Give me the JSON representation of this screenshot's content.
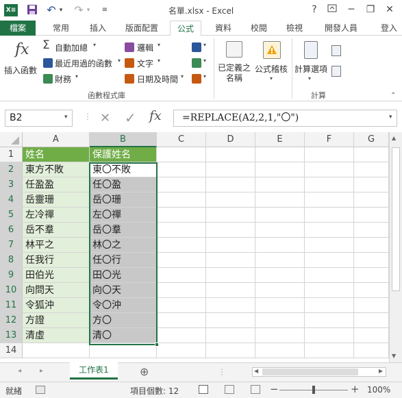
{
  "window": {
    "title": "名單.xlsx - Excel",
    "help": "?",
    "minimize": "─",
    "restore": "❐",
    "close": "✕",
    "sign_in": "登入"
  },
  "qat": {
    "excel_icon": "X≡",
    "save": "💾",
    "undo": "↶",
    "undo_arrow": "▾",
    "redo": "↷",
    "redo_arrow": "▾",
    "customize": "≡"
  },
  "tabs": [
    "檔案",
    "常用",
    "插入",
    "版面配置",
    "公式",
    "資料",
    "校閱",
    "檢視",
    "開發人員"
  ],
  "ribbon": {
    "insert_function": {
      "icon": "fx",
      "label": "插入函數"
    },
    "autosum": "自動加總",
    "recent": "最近用過的函數",
    "financial": "財務",
    "logical": "邏輯",
    "text": "文字",
    "datetime": "日期及時間",
    "group_library": "函數程式庫",
    "defined_names": "已定義之\n名稱",
    "formula_auditing": "公式稽核",
    "calc_options": "計算選項",
    "group_calc": "計算"
  },
  "formula_bar": {
    "name_box": "B2",
    "formula": "=REPLACE(A2,2,1,\"〇\")",
    "fx": "fx",
    "cancel": "✕",
    "enter": "✓"
  },
  "columns": [
    "A",
    "B",
    "C",
    "D",
    "E",
    "F",
    "G"
  ],
  "rows": [
    {
      "n": "1",
      "a": "姓名",
      "b": "保護姓名"
    },
    {
      "n": "2",
      "a": "東方不敗",
      "b": "東〇不敗"
    },
    {
      "n": "3",
      "a": "任盈盈",
      "b": "任〇盈"
    },
    {
      "n": "4",
      "a": "岳靈珊",
      "b": "岳〇珊"
    },
    {
      "n": "5",
      "a": "左冷禪",
      "b": "左〇禪"
    },
    {
      "n": "6",
      "a": "岳不羣",
      "b": "岳〇羣"
    },
    {
      "n": "7",
      "a": "林平之",
      "b": "林〇之"
    },
    {
      "n": "8",
      "a": "任我行",
      "b": "任〇行"
    },
    {
      "n": "9",
      "a": "田伯光",
      "b": "田〇光"
    },
    {
      "n": "10",
      "a": "向問天",
      "b": "向〇天"
    },
    {
      "n": "11",
      "a": "令狐沖",
      "b": "令〇沖"
    },
    {
      "n": "12",
      "a": "方證",
      "b": "方〇"
    },
    {
      "n": "13",
      "a": "清虛",
      "b": "清〇"
    },
    {
      "n": "14",
      "a": "",
      "b": ""
    }
  ],
  "sheet": {
    "tab": "工作表1",
    "add": "⊕",
    "nav_prev": "◂",
    "nav_next": "▸"
  },
  "status": {
    "ready": "就緒",
    "count": "項目個數: 12",
    "zoom_minus": "−",
    "zoom_plus": "+",
    "zoom": "100%"
  },
  "colors": {
    "excel_green": "#217346",
    "header_fill": "#70ad47",
    "col_a_fill": "#e2efda",
    "col_b_fill": "#c8c8c8",
    "selection": "#217346"
  }
}
